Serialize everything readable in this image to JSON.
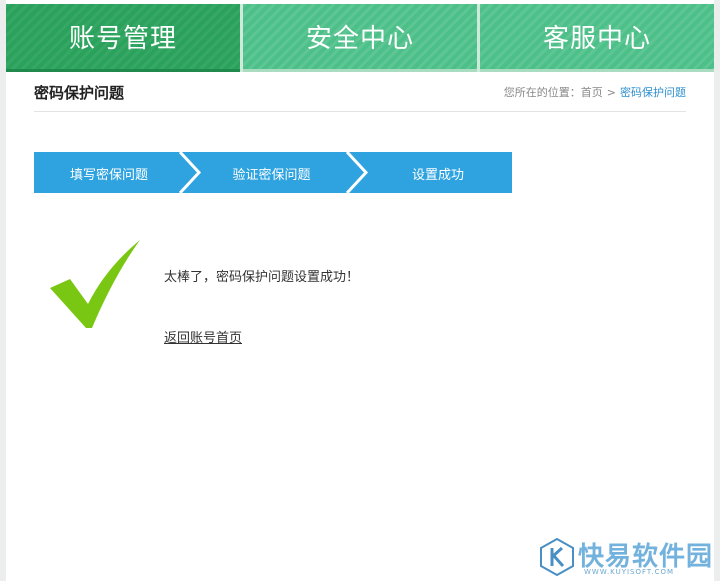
{
  "nav": {
    "tabs": [
      {
        "label": "账号管理",
        "active": true
      },
      {
        "label": "安全中心",
        "active": false
      },
      {
        "label": "客服中心",
        "active": false
      }
    ]
  },
  "header": {
    "title": "密码保护问题",
    "breadcrumb": {
      "prefix": "您所在的位置：",
      "home": "首页",
      "separator": ">",
      "current": "密码保护问题"
    }
  },
  "steps": [
    {
      "label": "填写密保问题"
    },
    {
      "label": "验证密保问题"
    },
    {
      "label": "设置成功"
    }
  ],
  "result": {
    "message": "太棒了，密码保护问题设置成功！",
    "back_link": "返回账号首页"
  },
  "watermark": {
    "text": "快易软件园",
    "sub": "WWW.KUYISOFT.COM"
  },
  "colors": {
    "nav_active": "#2aa25c",
    "nav_inactive": "#4cc088",
    "step_bar": "#2fa3e0",
    "check": "#7ac713",
    "link_blue": "#2d8fce"
  }
}
